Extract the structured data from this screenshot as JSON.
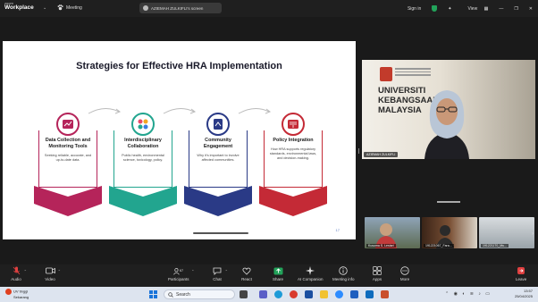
{
  "titlebar": {
    "brand_top": "zoom",
    "brand_bottom": "Workplace",
    "meeting_label": "Meeting",
    "share_chip": "AZIEMAH ZULKIFLI's screen",
    "signin": "Sign in",
    "view": "View",
    "colors": {
      "bg": "#1f1f1f",
      "shield": "#22a35a"
    }
  },
  "slide": {
    "title": "Strategies for Effective HRA Implementation",
    "page_number": "17",
    "cards": [
      {
        "title": "Data Collection and Monitoring Tools",
        "desc": "Seeking reliable, accurate, and up-to-date data.",
        "color": "#b5245a",
        "icon": "chart-icon"
      },
      {
        "title": "Interdisciplinary Collaboration",
        "desc": "Public health, environmental science, toxicology, policy.",
        "color": "#22a58f",
        "icon": "collaboration-icon"
      },
      {
        "title": "Community Engagement",
        "desc": "Why it's important to involve affected communities.",
        "color": "#2a3a86",
        "icon": "document-icon"
      },
      {
        "title": "Policy Integration",
        "desc": "How HRA supports regulatory standards, environmental laws, and decision-making.",
        "color": "#c42a36",
        "icon": "book-icon"
      }
    ]
  },
  "video": {
    "university": [
      "UNIVERSITI",
      "KEBANGSAAN",
      "MALAYSIA"
    ],
    "speaker_name": "AZIEMAH ZULKIFLI",
    "thumbs": [
      {
        "name": "Kusuma S. Lestari"
      },
      {
        "name": "191221067_Fara..."
      },
      {
        "name": "191221170_Mu..."
      }
    ]
  },
  "controls": {
    "audio": "Audio",
    "video": "Video",
    "participants": "Participants",
    "participant_count": "67",
    "chat": "Chat",
    "react": "React",
    "share": "Share",
    "ai": "AI Companion",
    "info": "Meeting info",
    "apps": "Apps",
    "more": "More",
    "leave": "Leave"
  },
  "taskbar": {
    "weather_title": "UV tinggi",
    "weather_sub": "Sekarang",
    "search": "Search",
    "time": "13:57",
    "date": "25/04/2025"
  }
}
